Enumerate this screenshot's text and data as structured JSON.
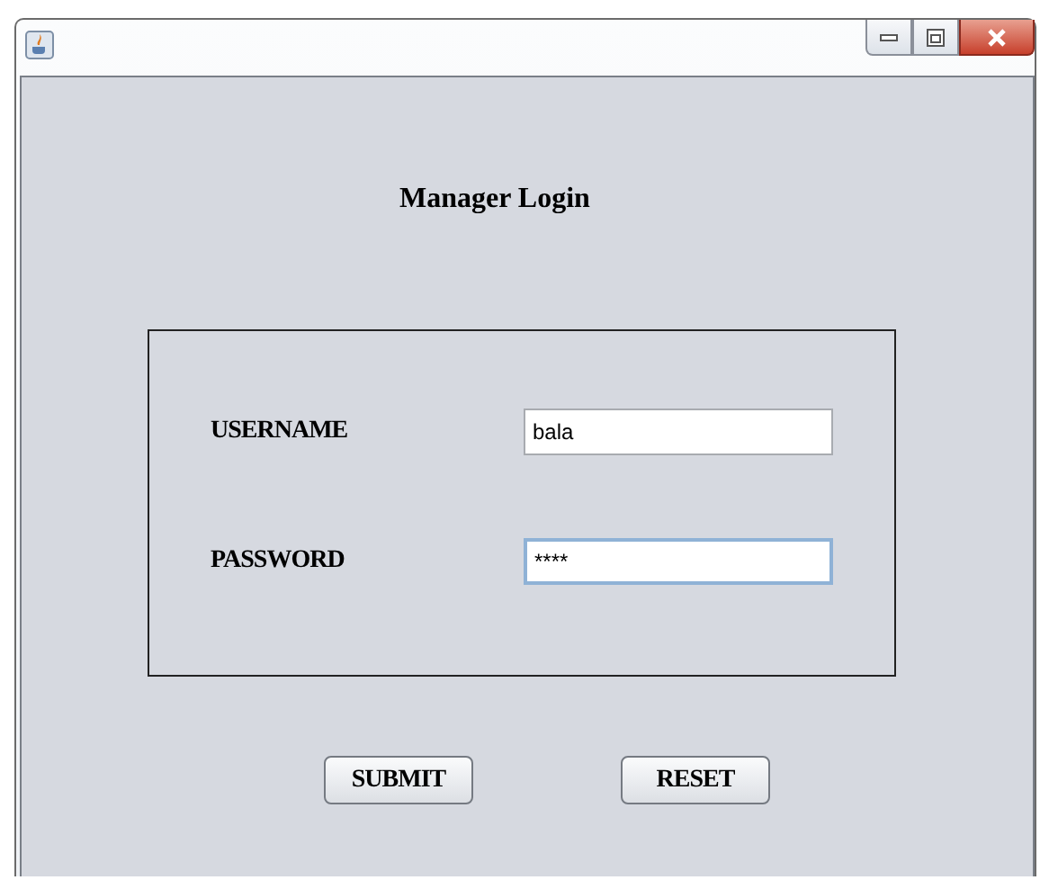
{
  "window": {
    "buttons": [
      {
        "kind": "minimize"
      },
      {
        "kind": "maximize"
      },
      {
        "kind": "close"
      }
    ]
  },
  "heading": "Manager Login",
  "fields": [
    {
      "label": "USERNAME",
      "value": "bala",
      "focused": false
    },
    {
      "label": "PASSWORD",
      "value": "****",
      "focused": true
    }
  ],
  "buttons": [
    "SUBMIT",
    "RESET"
  ]
}
